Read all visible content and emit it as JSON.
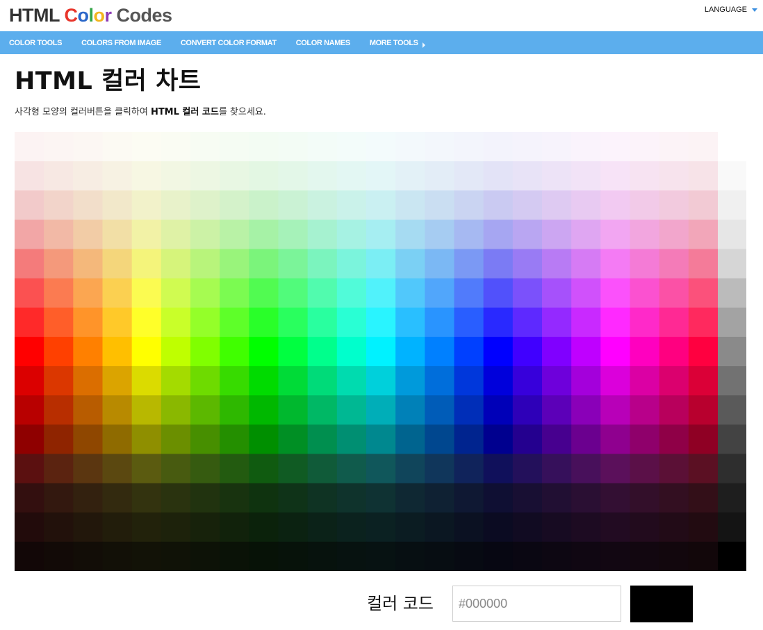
{
  "logo": {
    "l1": "HTML ",
    "letters": [
      "C",
      "o",
      "l",
      "o",
      "r"
    ],
    "l3": " Codes"
  },
  "language": {
    "label": "LANGUAGE"
  },
  "nav": {
    "items": [
      "COLOR TOOLS",
      "COLORS FROM IMAGE",
      "CONVERT COLOR FORMAT",
      "COLOR NAMES",
      "MORE TOOLS"
    ]
  },
  "page": {
    "title": "HTML 컬러 차트",
    "subtitle_pre": "사각형 모양의 컬러버튼을 클릭하여 ",
    "subtitle_bold": "HTML 컬러 코드",
    "subtitle_post": "를 찾으세요."
  },
  "picker": {
    "label": "컬러 코드",
    "placeholder": "#000000",
    "selected_color": "#000000"
  },
  "colors": {
    "nav_bg": "#5caeed",
    "swatch": "#000000"
  }
}
